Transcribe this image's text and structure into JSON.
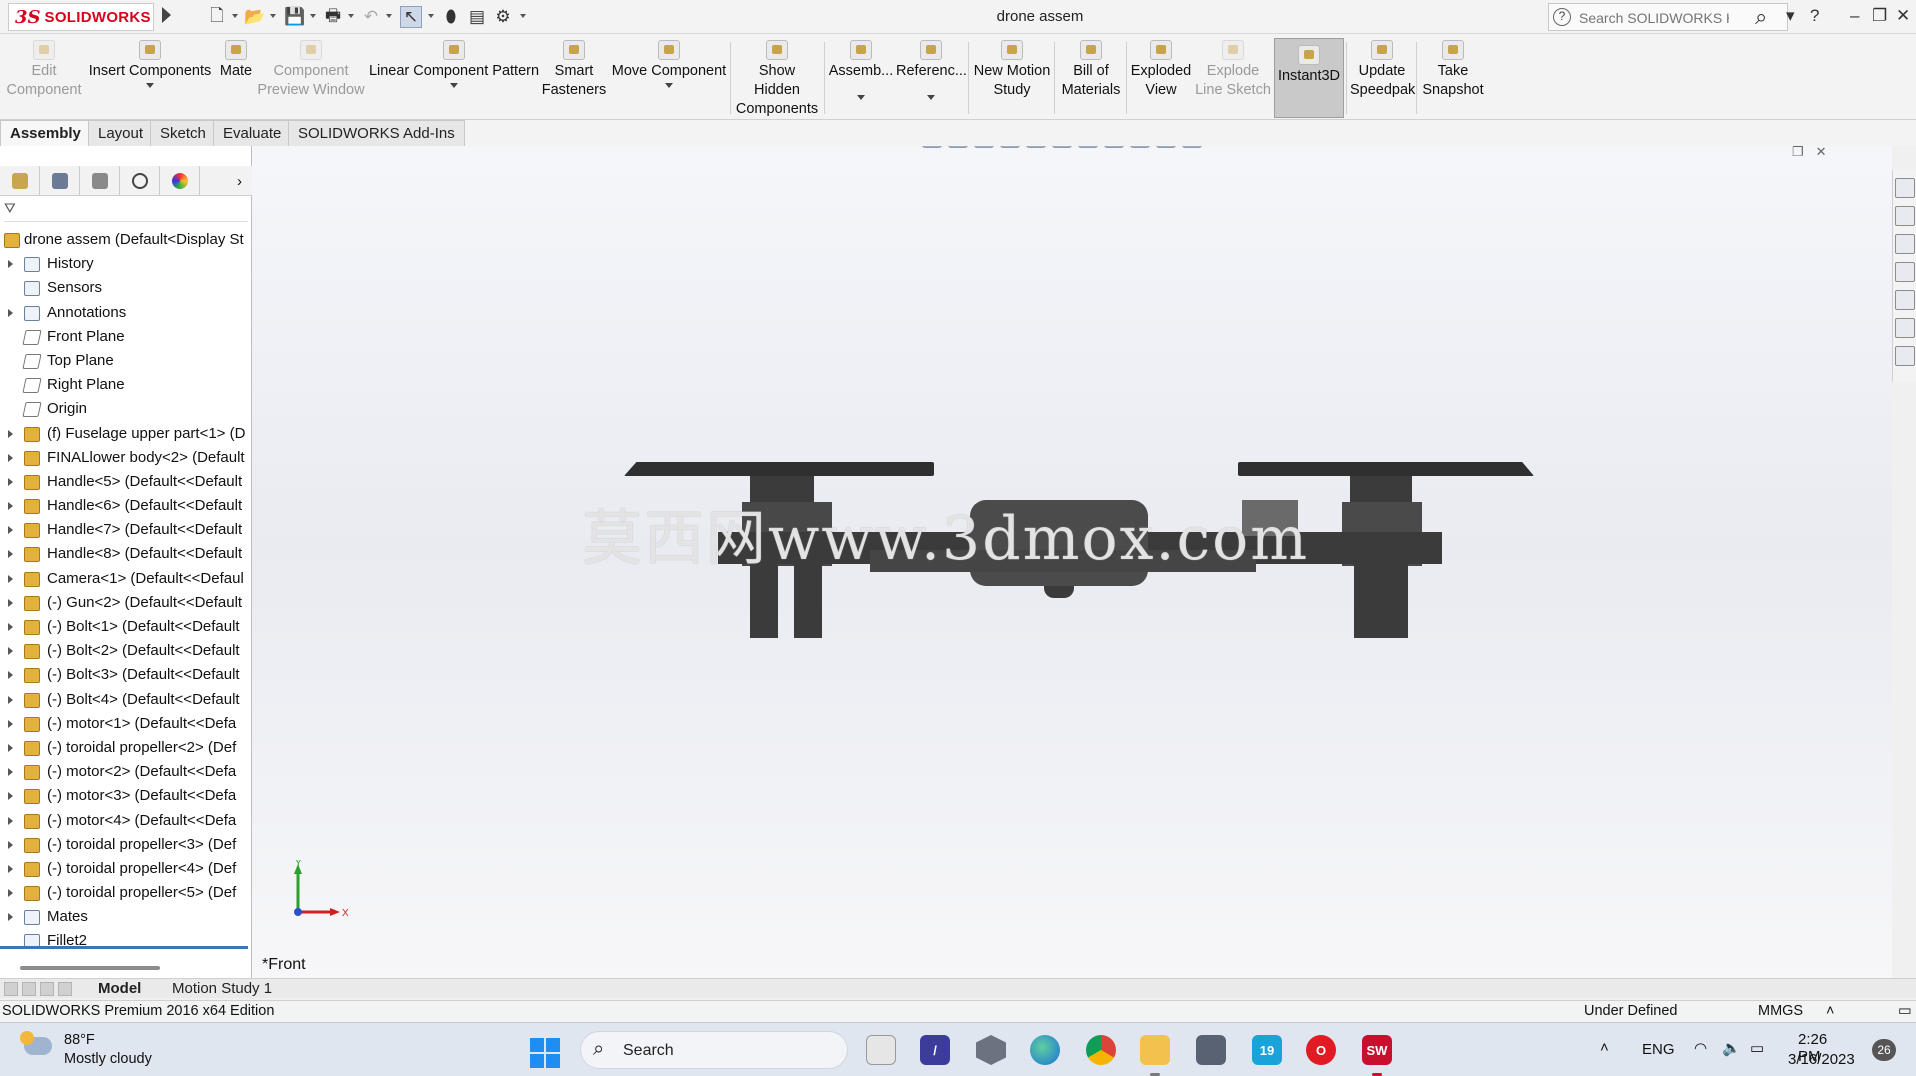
{
  "app": {
    "brand_ds": "3S",
    "brand_name": "SOLIDWORKS",
    "document_title": "drone assem",
    "search": {
      "placeholder": "Search SOLIDWORKS Help"
    },
    "window_controls": {
      "help": "?",
      "minimize": "–",
      "restore": "❐",
      "close": "✕"
    }
  },
  "commands": [
    {
      "line1": "Edit",
      "line2": "Component",
      "disabled": true
    },
    {
      "line1": "Insert Components",
      "line2": "",
      "disabled": false
    },
    {
      "line1": "Mate",
      "line2": "",
      "disabled": false
    },
    {
      "line1": "Component",
      "line2": "Preview Window",
      "disabled": true
    },
    {
      "line1": "Linear Component Pattern",
      "line2": "",
      "disabled": false
    },
    {
      "line1": "Smart",
      "line2": "Fasteners",
      "disabled": false
    },
    {
      "line1": "Move Component",
      "line2": "",
      "disabled": false
    },
    {
      "line1": "Show Hidden",
      "line2": "Components",
      "disabled": false
    },
    {
      "line1": "Assemb...",
      "line2": "",
      "disabled": false
    },
    {
      "line1": "Referenc...",
      "line2": "",
      "disabled": false
    },
    {
      "line1": "New Motion",
      "line2": "Study",
      "disabled": false
    },
    {
      "line1": "Bill of",
      "line2": "Materials",
      "disabled": false
    },
    {
      "line1": "Exploded",
      "line2": "View",
      "disabled": false
    },
    {
      "line1": "Explode",
      "line2": "Line Sketch",
      "disabled": true
    },
    {
      "line1": "Instant3D",
      "line2": "",
      "disabled": false,
      "active": true
    },
    {
      "line1": "Update",
      "line2": "Speedpak",
      "disabled": false
    },
    {
      "line1": "Take",
      "line2": "Snapshot",
      "disabled": false
    }
  ],
  "tabs": [
    "Assembly",
    "Layout",
    "Sketch",
    "Evaluate",
    "SOLIDWORKS Add-Ins"
  ],
  "feature_tree": {
    "root": "drone assem  (Default<Display St",
    "nodes": [
      {
        "label": "History",
        "expand": true,
        "icon": "folder"
      },
      {
        "label": "Sensors",
        "expand": false,
        "icon": "folder"
      },
      {
        "label": "Annotations",
        "expand": true,
        "icon": "folder"
      },
      {
        "label": "Front Plane",
        "expand": false,
        "icon": "plane"
      },
      {
        "label": "Top Plane",
        "expand": false,
        "icon": "plane"
      },
      {
        "label": "Right Plane",
        "expand": false,
        "icon": "plane"
      },
      {
        "label": "Origin",
        "expand": false,
        "icon": "origin"
      },
      {
        "label": "(f) Fuselage upper part<1> (D",
        "expand": true,
        "icon": "part"
      },
      {
        "label": "FINALlower body<2> (Default",
        "expand": true,
        "icon": "part"
      },
      {
        "label": "Handle<5> (Default<<Default",
        "expand": true,
        "icon": "part"
      },
      {
        "label": "Handle<6> (Default<<Default",
        "expand": true,
        "icon": "part"
      },
      {
        "label": "Handle<7> (Default<<Default",
        "expand": true,
        "icon": "part"
      },
      {
        "label": "Handle<8> (Default<<Default",
        "expand": true,
        "icon": "part"
      },
      {
        "label": "Camera<1> (Default<<Defaul",
        "expand": true,
        "icon": "part"
      },
      {
        "label": "(-) Gun<2> (Default<<Default",
        "expand": true,
        "icon": "part"
      },
      {
        "label": "(-) Bolt<1> (Default<<Default",
        "expand": true,
        "icon": "part"
      },
      {
        "label": "(-) Bolt<2> (Default<<Default",
        "expand": true,
        "icon": "part"
      },
      {
        "label": "(-) Bolt<3> (Default<<Default",
        "expand": true,
        "icon": "part"
      },
      {
        "label": "(-) Bolt<4> (Default<<Default",
        "expand": true,
        "icon": "part"
      },
      {
        "label": "(-) motor<1> (Default<<Defa",
        "expand": true,
        "icon": "part"
      },
      {
        "label": "(-) toroidal propeller<2> (Def",
        "expand": true,
        "icon": "part"
      },
      {
        "label": "(-) motor<2> (Default<<Defa",
        "expand": true,
        "icon": "part"
      },
      {
        "label": "(-) motor<3> (Default<<Defa",
        "expand": true,
        "icon": "part"
      },
      {
        "label": "(-) motor<4> (Default<<Defa",
        "expand": true,
        "icon": "part"
      },
      {
        "label": "(-) toroidal propeller<3> (Def",
        "expand": true,
        "icon": "part"
      },
      {
        "label": "(-) toroidal propeller<4> (Def",
        "expand": true,
        "icon": "part"
      },
      {
        "label": "(-) toroidal propeller<5> (Def",
        "expand": true,
        "icon": "part"
      },
      {
        "label": "Mates",
        "expand": true,
        "icon": "folder"
      },
      {
        "label": "Fillet2",
        "expand": false,
        "icon": "folder"
      }
    ]
  },
  "viewport": {
    "view_name": "*Front",
    "watermark": "莫西网www.3dmox.com",
    "triad": {
      "y": "Y",
      "x": "X"
    }
  },
  "bottom_tabs": [
    "Model",
    "Motion Study 1"
  ],
  "status": {
    "edition": "SOLIDWORKS Premium 2016 x64 Edition",
    "state": "Under Defined",
    "units": "MMGS"
  },
  "taskbar": {
    "weather_temp": "88°F",
    "weather_desc": "Mostly cloudy",
    "search_label": "Search",
    "language": "ENG",
    "time": "2:26 PM",
    "date": "3/16/2023",
    "notifications": "26"
  }
}
